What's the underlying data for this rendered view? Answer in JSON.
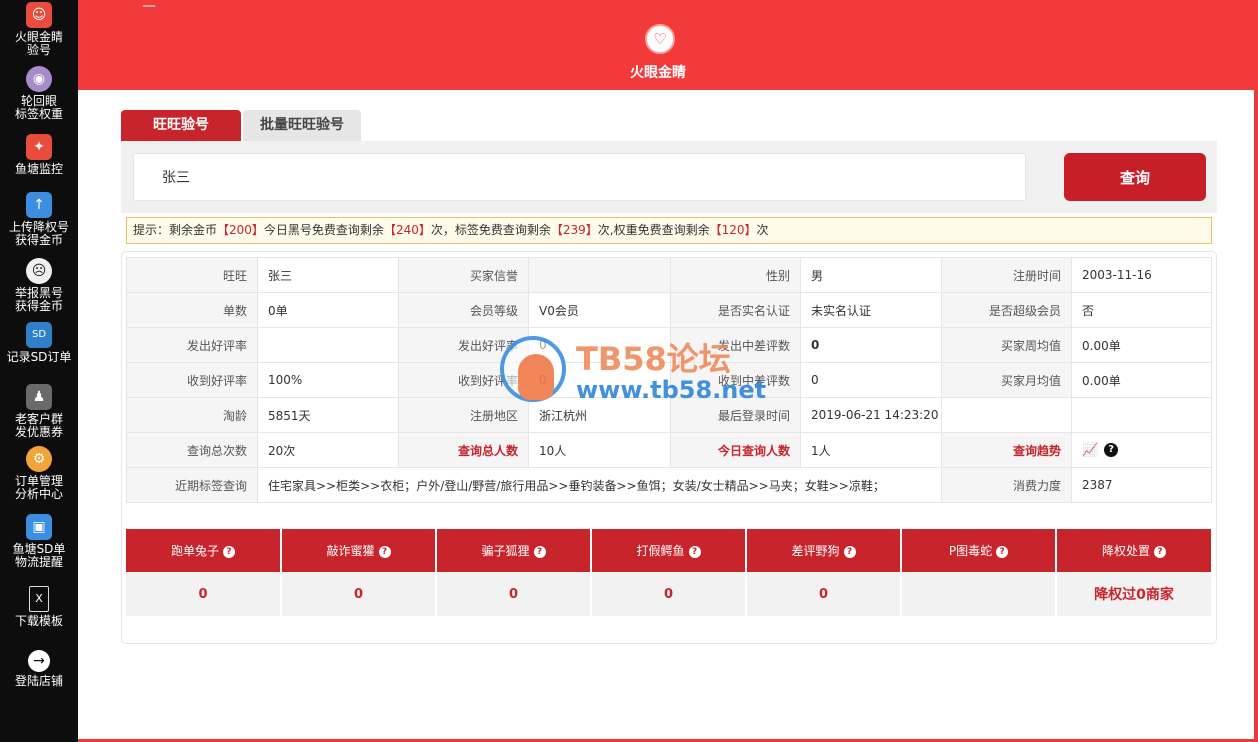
{
  "sidebar": {
    "items": [
      {
        "label": "火眼金睛\n验号",
        "icon": "eye-logo-icon"
      },
      {
        "label": "轮回眼\n标签权重",
        "icon": "rinnegan-icon"
      },
      {
        "label": "鱼塘监控",
        "icon": "fish-icon"
      },
      {
        "label": "上传降权号\n获得金币",
        "icon": "upload-icon"
      },
      {
        "label": "举报黑号\n获得金币",
        "icon": "report-icon"
      },
      {
        "label": "记录SD订单",
        "icon": "monitor-icon"
      },
      {
        "label": "老客户群\n发优惠券",
        "icon": "user-icon"
      },
      {
        "label": "订单管理\n分析中心",
        "icon": "gear-icon"
      },
      {
        "label": "鱼塘SD单\n物流提醒",
        "icon": "truck-icon"
      },
      {
        "label": "下载模板",
        "icon": "excel-file-icon"
      },
      {
        "label": "登陆店铺",
        "icon": "login-icon"
      }
    ]
  },
  "header": {
    "minimize": "—",
    "title": "火眼金睛"
  },
  "tabs": {
    "active": "旺旺验号",
    "batch": "批量旺旺验号"
  },
  "search": {
    "value": "张三",
    "button": "查询"
  },
  "notice": {
    "p1": "提示：剩余金币",
    "gold": "【200】",
    "p2": "今日黑号免费查询剩余",
    "black": "【240】",
    "p3": "次，标签免费查询剩余",
    "tag": "【239】",
    "p4": "次,权重免费查询剩余",
    "weight": "【120】",
    "p5": "次"
  },
  "info": {
    "r1": {
      "l1": "旺旺",
      "v1": "张三",
      "l2": "买家信誉",
      "v2": "",
      "l3": "性别",
      "v3": "男",
      "l4": "注册时间",
      "v4": "2003-11-16"
    },
    "r2": {
      "l1": "单数",
      "v1": "0单",
      "l2": "会员等级",
      "v2": "V0会员",
      "l3": "是否实名认证",
      "v3": "未实名认证",
      "l4": "是否超级会员",
      "v4": "否"
    },
    "r3": {
      "l1": "发出好评率",
      "v1": "",
      "l2": "发出好评率",
      "v2": "0",
      "l3": "发出中差评数",
      "v3": "0",
      "l4": "买家周均值",
      "v4": "0.00单"
    },
    "r4": {
      "l1": "收到好评率",
      "v1": "100%",
      "l2": "收到好评率",
      "v2": "0",
      "l3": "收到中差评数",
      "v3": "0",
      "l4": "买家月均值",
      "v4": "0.00单"
    },
    "r5": {
      "l1": "淘龄",
      "v1": "5851天",
      "l2": "注册地区",
      "v2": "浙江杭州",
      "l3": "最后登录时间",
      "v3": "2019-06-21 14:23:20",
      "l4": "",
      "v4": ""
    },
    "r6": {
      "l1": "查询总次数",
      "v1": "20次",
      "l2": "查询总人数",
      "v2": "10人",
      "l3": "今日查询人数",
      "v3": "1人",
      "l4": "查询趋势",
      "v4": ""
    },
    "r7": {
      "l1": "近期标签查询",
      "v1": "住宅家具>>柜类>>衣柜；户外/登山/野营/旅行用品>>垂钓装备>>鱼饵；女装/女士精品>>马夹；女鞋>>凉鞋；",
      "l4": "消费力度",
      "v4": "2387"
    }
  },
  "risk": {
    "headers": [
      "跑单兔子",
      "敲诈蜜獾",
      "骗子狐狸",
      "打假鳄鱼",
      "差评野狗",
      "P图毒蛇",
      "降权处置"
    ],
    "values": [
      "0",
      "0",
      "0",
      "0",
      "0",
      "",
      "降权过0商家"
    ]
  },
  "watermark": {
    "title": "TB58论坛",
    "url": "www.tb58.net"
  },
  "colors": {
    "brand": "#f23a3a",
    "accent": "#c8242c",
    "sidebar": "#0d0d0d"
  }
}
